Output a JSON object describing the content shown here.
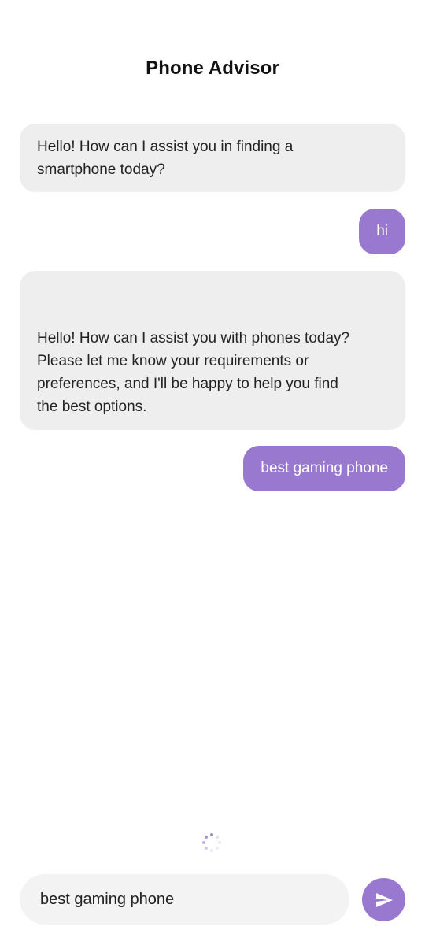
{
  "app": {
    "title": "Phone Advisor"
  },
  "messages": [
    {
      "role": "bot",
      "text": "Hello! How can I assist you in finding a\nsmartphone today?"
    },
    {
      "role": "user",
      "text": "hi"
    },
    {
      "role": "bot",
      "text": "Hello! How can I assist you with phones today?\nPlease let me know your requirements or\npreferences, and I'll be happy to help you find\nthe best options."
    },
    {
      "role": "user",
      "text": "best gaming phone"
    }
  ],
  "composer": {
    "value": "best gaming phone",
    "send_icon": "send-icon"
  },
  "status": {
    "loading_icon": "loading-spinner-icon"
  },
  "colors": {
    "accent": "#9978cf",
    "bot_bubble": "#eeeeee",
    "input_background": "#f3f3f3"
  }
}
